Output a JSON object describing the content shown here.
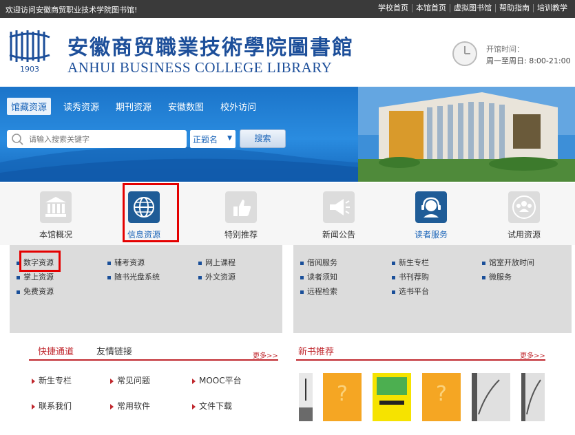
{
  "topbar": {
    "welcome": "欢迎访问安徽商贸职业技术学院图书馆!",
    "links": [
      "学校首页",
      "本馆首页",
      "虚拟图书馆",
      "帮助指南",
      "培训教学"
    ]
  },
  "header": {
    "logo_year": "1903",
    "title_cn": "安徽商贸職業技術學院圖書館",
    "title_en": "ANHUI BUSINESS COLLEGE LIBRARY",
    "hours_label": "开馆时间：",
    "hours_value": "周一至周日: 8:00-21:00"
  },
  "search": {
    "tabs": [
      "馆藏资源",
      "读秀资源",
      "期刊资源",
      "安徽数图",
      "校外访问"
    ],
    "active_tab": "馆藏资源",
    "placeholder": "请输入搜索关键字",
    "select_value": "正题名",
    "button": "搜索"
  },
  "nav": {
    "items": [
      {
        "label": "本馆概况",
        "icon": "library-building-icon"
      },
      {
        "label": "信息资源",
        "icon": "globe-icon"
      },
      {
        "label": "特别推荐",
        "icon": "thumbs-up-icon"
      },
      {
        "label": "新闻公告",
        "icon": "megaphone-icon"
      },
      {
        "label": "读者服务",
        "icon": "headset-agent-icon"
      },
      {
        "label": "试用资源",
        "icon": "users-group-icon"
      }
    ]
  },
  "resources_panel": {
    "col1": [
      "数字资源",
      "掌上资源",
      "免费资源"
    ],
    "col2": [
      "辅考资源",
      "随书光盘系统"
    ],
    "col3": [
      "网上课程",
      "外文资源"
    ]
  },
  "service_panel": {
    "col1": [
      "借阅服务",
      "读者须知",
      "远程检索"
    ],
    "col2": [
      "新生专栏",
      "书刊荐购",
      "选书平台"
    ],
    "col3": [
      "馆室开放时间",
      "微服务"
    ]
  },
  "quick": {
    "tab_active": "快捷通道",
    "tab_other": "友情链接",
    "more": "更多>>",
    "items": [
      "新生专栏",
      "常见问题",
      "MOOC平台",
      "联系我们",
      "常用软件",
      "文件下载"
    ]
  },
  "new_books": {
    "title": "新书推荐",
    "more": "更多>>"
  },
  "colors": {
    "brand_blue": "#1d4f9a",
    "banner_blue": "#2a8ce0",
    "accent_red": "#c0272d",
    "highlight_red": "#e40000"
  }
}
